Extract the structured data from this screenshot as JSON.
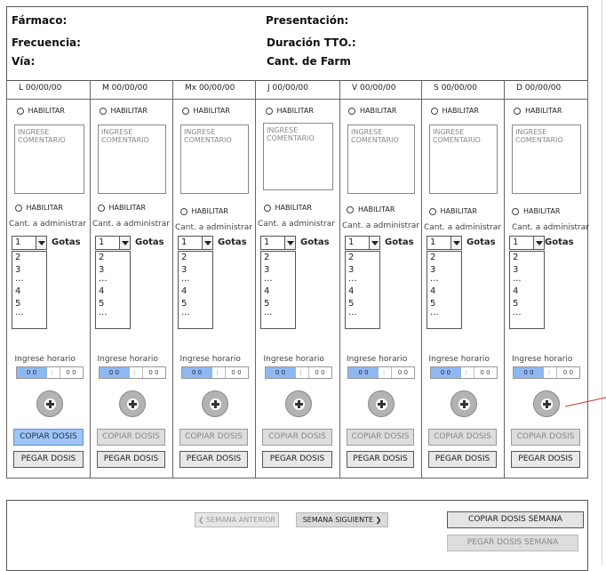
{
  "header": {
    "farmaco": "Fármaco:",
    "presentacion": "Presentación:",
    "frecuencia": "Frecuencia:",
    "duracion": "Duración TTO.:",
    "via": "Vía:",
    "cant_farm": "Cant. de Farm"
  },
  "days": [
    {
      "label": "L  00/00/00"
    },
    {
      "label": "M  00/00/00"
    },
    {
      "label": "Mx  00/00/00"
    },
    {
      "label": "J  00/00/00"
    },
    {
      "label": "V  00/00/00"
    },
    {
      "label": "S  00/00/00"
    },
    {
      "label": "D  00/00/00"
    }
  ],
  "common": {
    "habilitar": "HABILITAR",
    "comment_placeholder": "INGRESE COMENTARIO",
    "cant_label": "Cant. a administrar",
    "select_value": "1",
    "unit": "Gotas",
    "list_options": [
      "2",
      "3",
      "...",
      "4",
      "5",
      "..."
    ],
    "horario_label": "Ingrese horario",
    "time_hh": "0 0",
    "time_sep": ":",
    "time_mm": "0 0",
    "copy_label": "COPIAR DOSIS",
    "paste_label": "PEGAR DOSIS"
  },
  "footer": {
    "prev_label": "SEMANA ANTERIOR",
    "next_label": "SEMANA SIGUIENTE",
    "copy_week_label": "COPIAR DOSIS SEMANA",
    "paste_week_label": "PEGAR DOSIS SEMANA"
  },
  "colors": {
    "active_button": "#9ec5f7",
    "time_highlight": "#8fb8f0",
    "connector": "#c0392b"
  }
}
